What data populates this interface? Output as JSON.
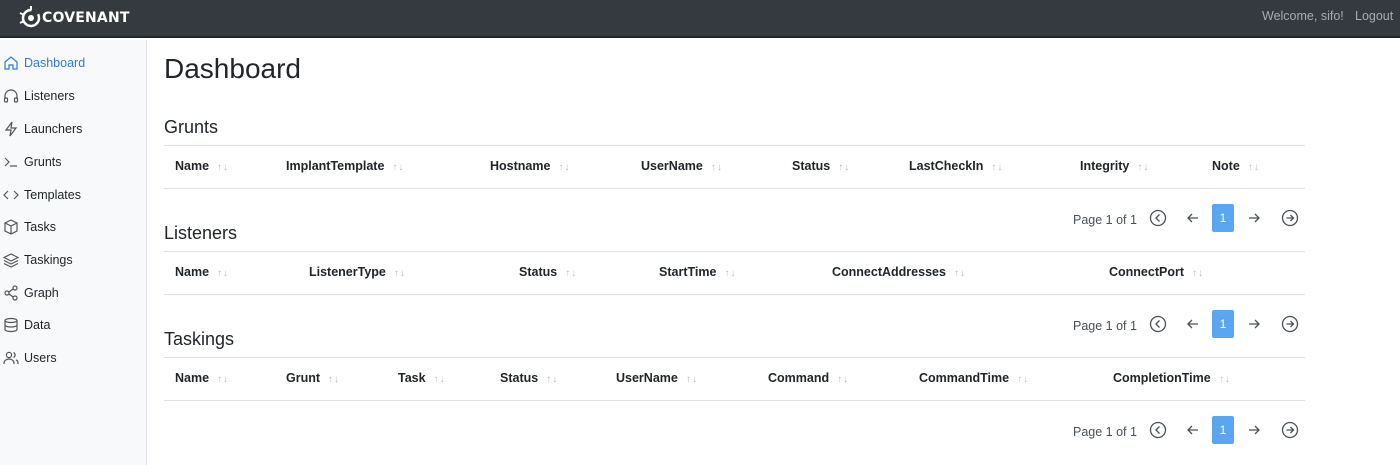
{
  "header": {
    "brand": "COVENANT",
    "welcome": "Welcome, sifo!",
    "logout": "Logout"
  },
  "sidebar": {
    "items": [
      {
        "label": "Dashboard",
        "icon": "home-icon",
        "active": true
      },
      {
        "label": "Listeners",
        "icon": "headphones-icon"
      },
      {
        "label": "Launchers",
        "icon": "lightning-icon"
      },
      {
        "label": "Grunts",
        "icon": "terminal-icon"
      },
      {
        "label": "Templates",
        "icon": "code-icon"
      },
      {
        "label": "Tasks",
        "icon": "box-icon"
      },
      {
        "label": "Taskings",
        "icon": "layers-icon"
      },
      {
        "label": "Graph",
        "icon": "share-icon"
      },
      {
        "label": "Data",
        "icon": "database-icon"
      },
      {
        "label": "Users",
        "icon": "users-icon"
      }
    ]
  },
  "main": {
    "title": "Dashboard",
    "sections": [
      {
        "title": "Grunts",
        "columns": [
          "Name",
          "ImplantTemplate",
          "Hostname",
          "UserName",
          "Status",
          "LastCheckIn",
          "Integrity",
          "Note"
        ],
        "rows": [],
        "pagination": {
          "info": "Page 1 of 1",
          "current": "1"
        }
      },
      {
        "title": "Listeners",
        "columns": [
          "Name",
          "ListenerType",
          "Status",
          "StartTime",
          "ConnectAddresses",
          "ConnectPort"
        ],
        "rows": [],
        "pagination": {
          "info": "Page 1 of 1",
          "current": "1"
        }
      },
      {
        "title": "Taskings",
        "columns": [
          "Name",
          "Grunt",
          "Task",
          "Status",
          "UserName",
          "Command",
          "CommandTime",
          "CompletionTime"
        ],
        "rows": [],
        "pagination": {
          "info": "Page 1 of 1",
          "current": "1"
        }
      }
    ]
  },
  "colors": {
    "navbar": "#343a40",
    "sidebar": "#f8f9fa",
    "accent": "#2f7ad8",
    "page_active": "#5aa6f0"
  }
}
